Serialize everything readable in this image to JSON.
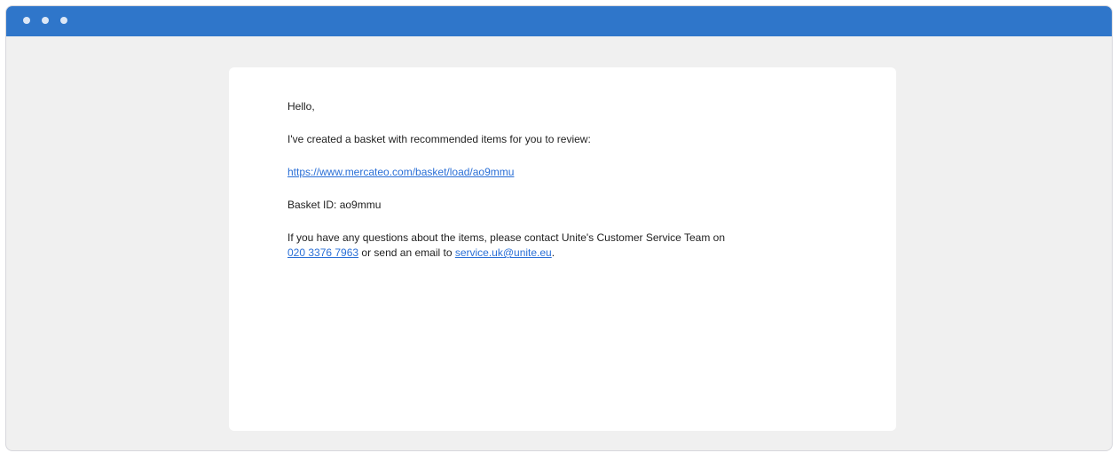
{
  "window": {
    "titlebar_color": "#2f76ca",
    "background_color": "#f0f0f0"
  },
  "email": {
    "greeting": "Hello,",
    "intro": "I've created a basket with recommended items for you to review:",
    "basket_link": "https://www.mercateo.com/basket/load/ao9mmu",
    "basket_id_line": "Basket ID: ao9mmu",
    "contact_text_1": "If you have any questions about the items, please contact Unite's Customer Service Team on",
    "phone_link": "020 3376 7963",
    "contact_text_2": " or send an email to ",
    "email_link": "service.uk@unite.eu",
    "contact_text_3": "."
  },
  "colors": {
    "link": "#2a6fd6"
  }
}
